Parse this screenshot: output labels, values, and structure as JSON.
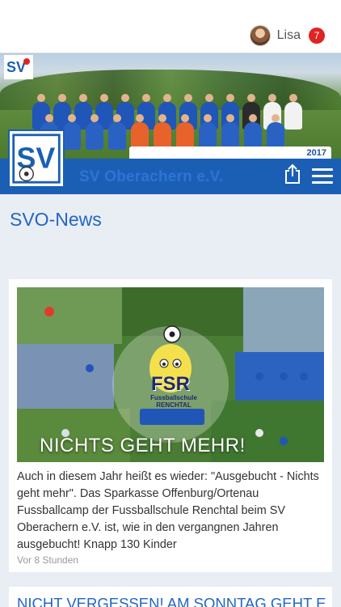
{
  "user": {
    "name": "Lisa",
    "notification_count": "7"
  },
  "hero": {
    "year": "2017",
    "club_name": "SV Oberachern e.V."
  },
  "section": {
    "title": "SVO-News"
  },
  "news": [
    {
      "title": "NICHTS GEHT MEHR!",
      "text": "Auch in diesem Jahr heißt es wieder: \"Ausgebucht - Nichts geht mehr\". Das Sparkasse Offenburg/Ortenau Fussballcamp der Fussballschule Renchtal beim SV Oberachern e.V. ist, wie in den vergangnen Jahren ausgebucht! Knapp 130 Kinder",
      "time": "Vor 8 Stunden",
      "logo_text": "FSR",
      "logo_subtext": "Fussballschule RENCHTAL"
    },
    {
      "title": "NICHT VERGESSEN! AM SONNTAG GEHT E"
    }
  ],
  "colors": {
    "brand_blue": "#1b5fb5",
    "link_blue": "#2267c2",
    "badge_red": "#e02424",
    "background": "#e9eef5"
  },
  "icons": [
    "share-icon",
    "menu-icon",
    "avatar"
  ]
}
